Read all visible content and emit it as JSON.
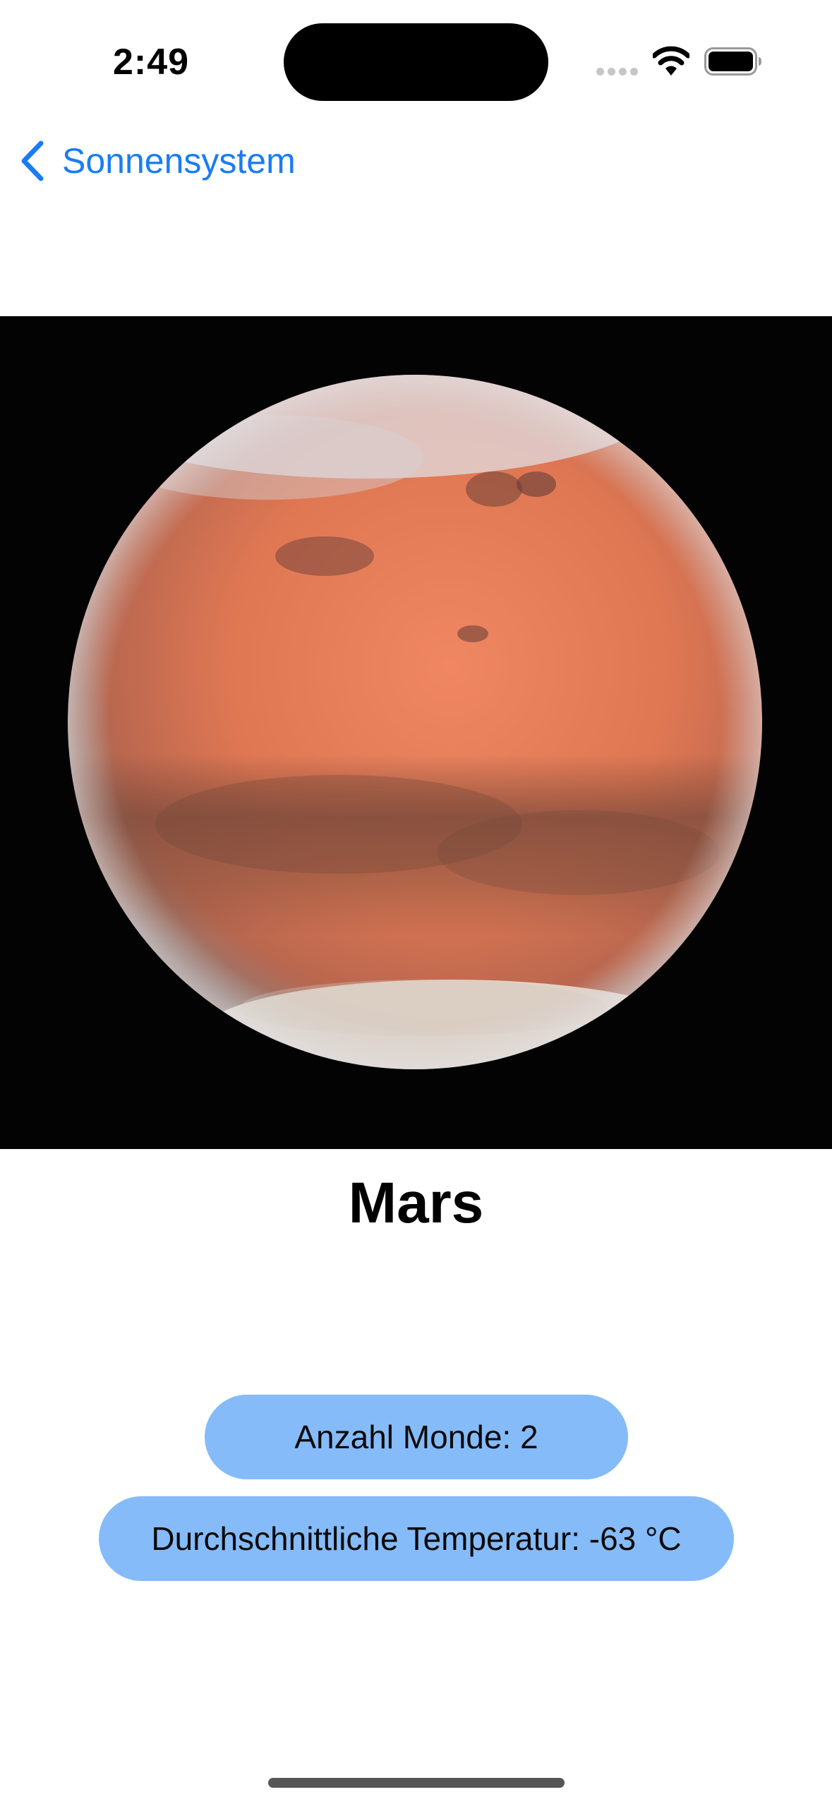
{
  "status_bar": {
    "time": "2:49",
    "icons": [
      "signal-icon",
      "wifi-icon",
      "battery-icon"
    ]
  },
  "navigation": {
    "back_label": "Sonnensystem",
    "back_icon": "chevron-left-icon"
  },
  "planet": {
    "name": "Mars",
    "image_subject": "mars-planet-image",
    "stats": {
      "moons": "Anzahl Monde: 2",
      "temperature": "Durchschnittliche Temperatur: -63 °C"
    }
  },
  "colors": {
    "accent": "#1a7cf4",
    "pill_background": "#85bbf9",
    "image_background": "#030303",
    "planet_orange": "#e0744f"
  }
}
